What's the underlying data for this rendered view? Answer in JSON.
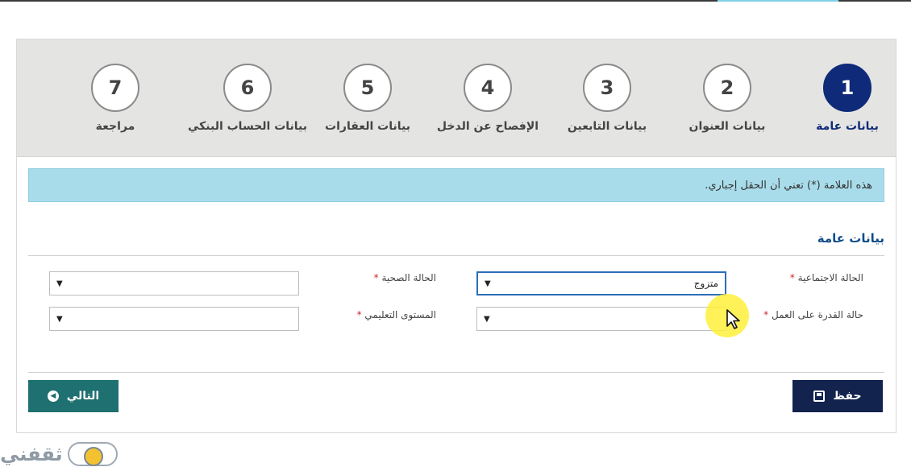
{
  "wizard": {
    "steps": [
      {
        "number": "1",
        "label": "بيانات عامة",
        "active": true
      },
      {
        "number": "2",
        "label": "بيانات العنوان"
      },
      {
        "number": "3",
        "label": "بيانات التابعين"
      },
      {
        "number": "4",
        "label": "الإفصاح عن الدخل"
      },
      {
        "number": "5",
        "label": "بيانات العقارات"
      },
      {
        "number": "6",
        "label": "بيانات الحساب البنكي"
      },
      {
        "number": "7",
        "label": "مراجعة"
      }
    ]
  },
  "notice": "هذه العلامة (*) تعني أن الحقل إجباري.",
  "section": {
    "title": "بيانات عامة"
  },
  "form": {
    "marital_status": {
      "label": "الحالة الاجتماعية",
      "value": "متزوج"
    },
    "health_status": {
      "label": "الحالة الصحية",
      "value": ""
    },
    "work_ability": {
      "label": "حالة القدرة على العمل",
      "value": ""
    },
    "education_level": {
      "label": "المستوى التعليمي",
      "value": ""
    },
    "required_mark": "*",
    "dropdown_glyph": "▼"
  },
  "actions": {
    "save_label": "حفظ",
    "next_label": "التالي"
  },
  "watermark": {
    "text": "ثقفني"
  },
  "colors": {
    "active_step": "#0f2a78",
    "notice_bg": "#a9dcea",
    "save_button": "#12234d",
    "next_button": "#1f7070"
  }
}
